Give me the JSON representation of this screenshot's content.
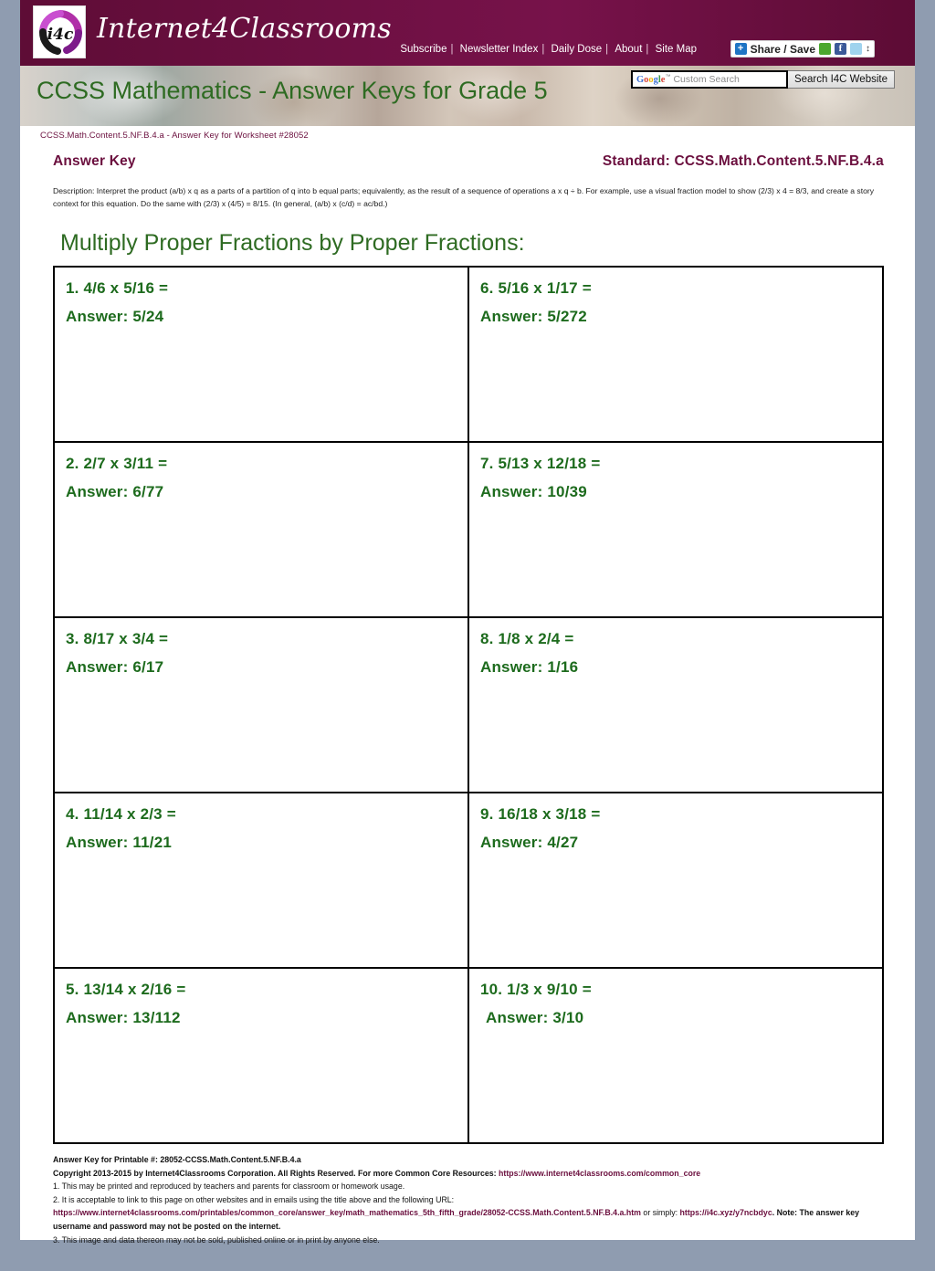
{
  "site": {
    "brand": "Internet4Classrooms",
    "logo_text": "i4c"
  },
  "topnav": {
    "items": [
      {
        "label": "Subscribe"
      },
      {
        "label": "Newsletter Index"
      },
      {
        "label": "Daily Dose"
      },
      {
        "label": "About"
      },
      {
        "label": "Site Map"
      }
    ],
    "share_label": "Share / Save"
  },
  "search": {
    "placeholder": "Custom Search",
    "google_label": "Google",
    "tm": "™",
    "button_label": "Search I4C Website"
  },
  "header": {
    "page_title": "CCSS Mathematics - Answer Keys for Grade 5",
    "breadcrumb": "CCSS.Math.Content.5.NF.B.4.a - Answer Key for Worksheet #28052",
    "answer_key_label": "Answer Key",
    "standard_label": "Standard: CCSS.Math.Content.5.NF.B.4.a",
    "description": "Description: Interpret the product (a/b) x q as a parts of a partition of q into b equal parts; equivalently, as the result of a sequence of operations a x q ÷ b. For example, use a visual fraction model to show (2/3) x 4 = 8/3, and create a story context for this equation. Do the same with (2/3) x (4/5) = 8/15. (In general, (a/b) x (c/d) = ac/bd.)"
  },
  "worksheet": {
    "heading": "Multiply Proper Fractions by Proper Fractions:",
    "problems": [
      {
        "q": "1. 4/6 x 5/16 =",
        "a": "Answer: 5/24"
      },
      {
        "q": "2. 2/7 x 3/11 =",
        "a": "Answer: 6/77"
      },
      {
        "q": "3. 8/17 x 3/4 =",
        "a": "Answer: 6/17"
      },
      {
        "q": "4. 11/14 x 2/3 =",
        "a": "Answer: 11/21"
      },
      {
        "q": "5. 13/14 x 2/16 =",
        "a": "Answer: 13/112"
      },
      {
        "q": "6. 5/16 x 1/17 =",
        "a": "Answer: 5/272"
      },
      {
        "q": "7. 5/13 x 12/18 =",
        "a": "Answer: 10/39"
      },
      {
        "q": "8. 1/8 x 2/4 =",
        "a": "Answer: 1/16"
      },
      {
        "q": "9. 16/18 x 3/18 =",
        "a": "Answer: 4/27"
      },
      {
        "q": "10. 1/3 x 9/10 =",
        "a": "Answer: 3/10"
      }
    ]
  },
  "footer": {
    "printable_line": "Answer Key for Printable #: 28052-CCSS.Math.Content.5.NF.B.4.a",
    "copyright_text": "Copyright 2013-2015 by Internet4Classrooms Corporation. All Rights Reserved. For more Common Core Resources: ",
    "copyright_url": "https://www.internet4classrooms.com/common_core",
    "terms_1": "1. This may be printed and reproduced by teachers and parents for classroom or homework usage.",
    "terms_2": "2. It is acceptable to link to this page on other websites and in emails using the title above and the following URL:",
    "terms_2_url": "https://www.internet4classrooms.com/printables/common_core/answer_key/math_mathematics_5th_fifth_grade/28052-CCSS.Math.Content.5.NF.B.4.a.htm",
    "terms_2_mid": " or simply: ",
    "terms_2_short_url": "https://i4c.xyz/y7ncbdyc",
    "terms_2_note": ". Note: The answer key username and password may not be posted on the internet.",
    "terms_3": "3. This image and data thereon may not be sold, published online or in print by anyone else."
  },
  "colors": {
    "brand_maroon": "#6b0f3e",
    "heading_green": "#2e6b22",
    "answer_green": "#1d6b1d",
    "page_bg": "#8f9cb0"
  }
}
